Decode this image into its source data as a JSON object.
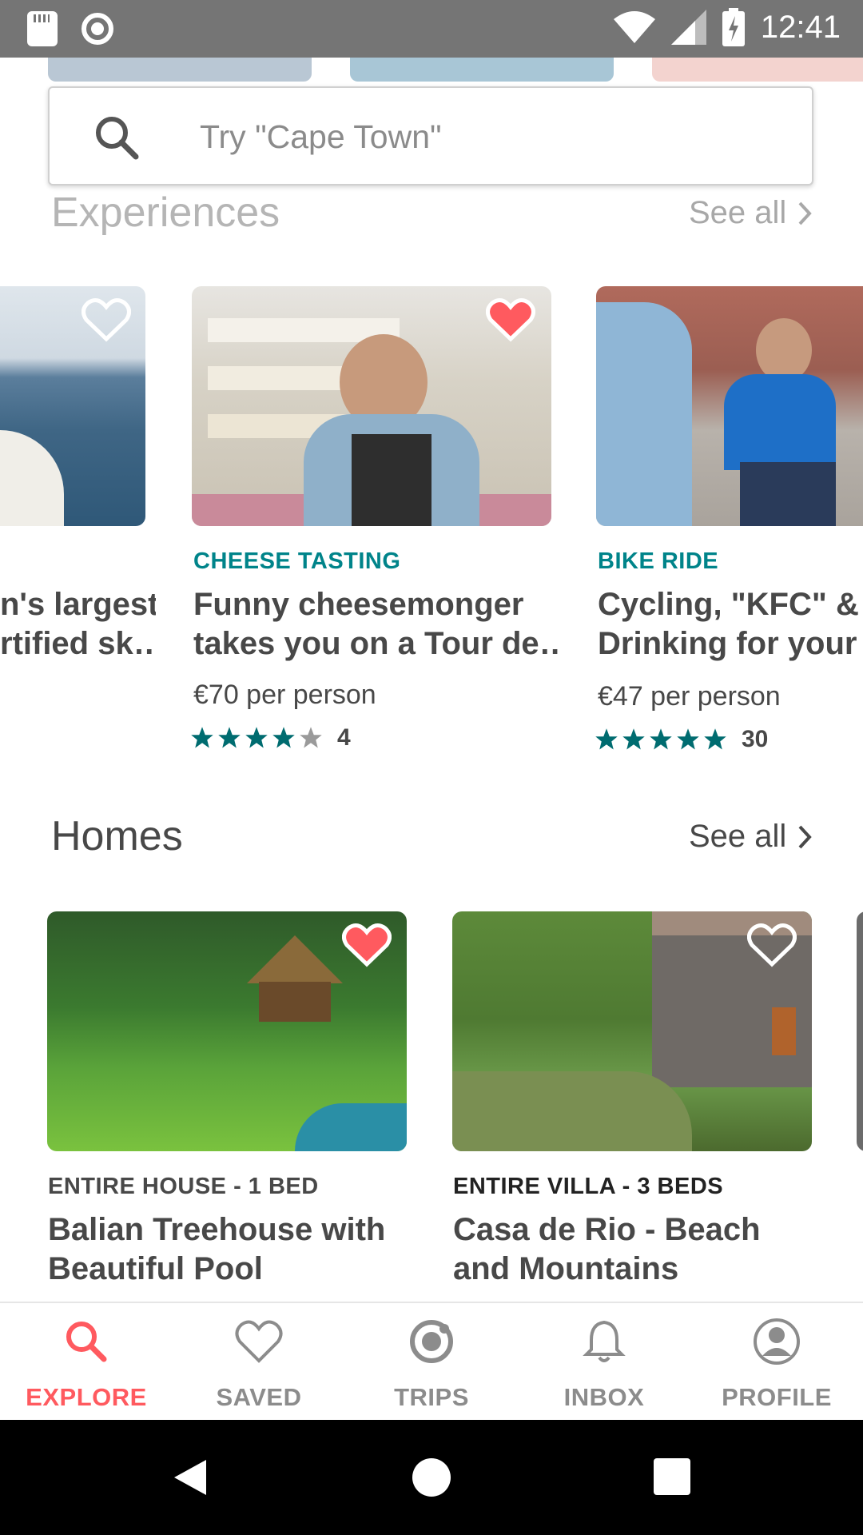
{
  "status_bar": {
    "time": "12:41"
  },
  "search": {
    "placeholder": "Try \"Cape Town\""
  },
  "experiences": {
    "title": "Experiences",
    "see_all": "See all",
    "cards": [
      {
        "category": "",
        "title_line1": "n's largest",
        "title_line2": "rtified sk…",
        "price": "",
        "rating_count": "",
        "saved": false
      },
      {
        "category": "CHEESE TASTING",
        "title_line1": "Funny cheesemonger",
        "title_line2": "takes you on a Tour de…",
        "price": "€70 per person",
        "stars": 4,
        "rating_count": "4",
        "saved": true
      },
      {
        "category": "BIKE RIDE",
        "title_line1": "Cycling, \"KFC\" &",
        "title_line2": "Drinking for your S",
        "price": "€47 per person",
        "stars": 5,
        "rating_count": "30",
        "saved": false
      }
    ]
  },
  "homes": {
    "title": "Homes",
    "see_all": "See all",
    "cards": [
      {
        "category": "ENTIRE HOUSE - 1 BED",
        "title_line1": "Balian Treehouse with",
        "title_line2": "Beautiful Pool",
        "saved": true
      },
      {
        "category": "ENTIRE VILLA - 3 BEDS",
        "title_line1": "Casa de Rio - Beach",
        "title_line2": "and Mountains",
        "saved": false
      }
    ]
  },
  "bottom_nav": [
    {
      "label": "EXPLORE",
      "icon": "search-icon",
      "active": true
    },
    {
      "label": "SAVED",
      "icon": "heart-icon",
      "active": false
    },
    {
      "label": "TRIPS",
      "icon": "trips-icon",
      "active": false
    },
    {
      "label": "INBOX",
      "icon": "bell-icon",
      "active": false
    },
    {
      "label": "PROFILE",
      "icon": "profile-icon",
      "active": false
    }
  ],
  "colors": {
    "accent": "#FF5A5F",
    "teal": "#00848A",
    "star": "#006C70",
    "text": "#484848"
  }
}
